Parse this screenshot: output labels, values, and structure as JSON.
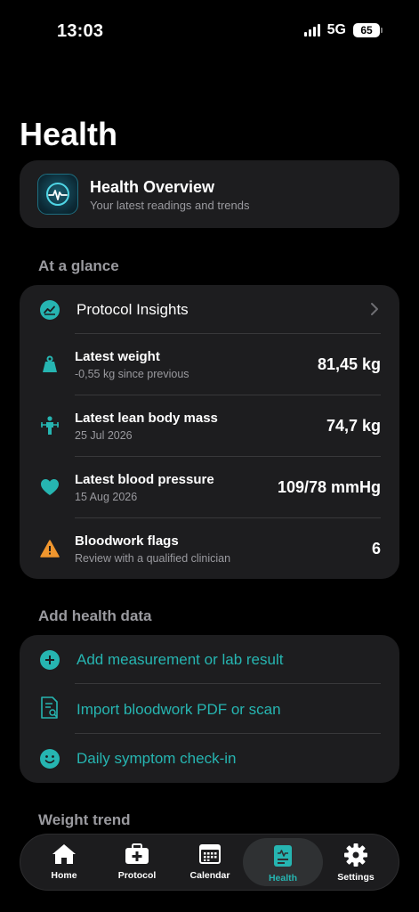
{
  "status": {
    "time": "13:03",
    "network": "5G",
    "battery": "65"
  },
  "page": {
    "title": "Health"
  },
  "overview": {
    "title": "Health Overview",
    "subtitle": "Your latest readings and trends"
  },
  "glance": {
    "label": "At a glance",
    "insights_label": "Protocol Insights",
    "rows": [
      {
        "title": "Latest weight",
        "subtitle": "-0,55 kg since previous",
        "value": "81,45 kg"
      },
      {
        "title": "Latest lean body mass",
        "subtitle": "25 Jul 2026",
        "value": "74,7 kg"
      },
      {
        "title": "Latest blood pressure",
        "subtitle": "15 Aug 2026",
        "value": "109/78 mmHg"
      },
      {
        "title": "Bloodwork flags",
        "subtitle": "Review with a qualified clinician",
        "value": "6"
      }
    ]
  },
  "add": {
    "label": "Add health data",
    "items": [
      {
        "label": "Add measurement or lab result"
      },
      {
        "label": "Import bloodwork PDF or scan"
      },
      {
        "label": "Daily symptom check-in"
      }
    ]
  },
  "weight_trend": {
    "label": "Weight trend"
  },
  "tabs": [
    {
      "label": "Home",
      "icon": "house-icon"
    },
    {
      "label": "Protocol",
      "icon": "medkit-icon"
    },
    {
      "label": "Calendar",
      "icon": "calendar-icon"
    },
    {
      "label": "Health",
      "icon": "clipboard-icon",
      "active": true
    },
    {
      "label": "Settings",
      "icon": "gear-icon"
    }
  ],
  "colors": {
    "accent": "#26b5b1",
    "warning": "#f0962e",
    "card": "#1d1d1f",
    "background": "#000000"
  }
}
